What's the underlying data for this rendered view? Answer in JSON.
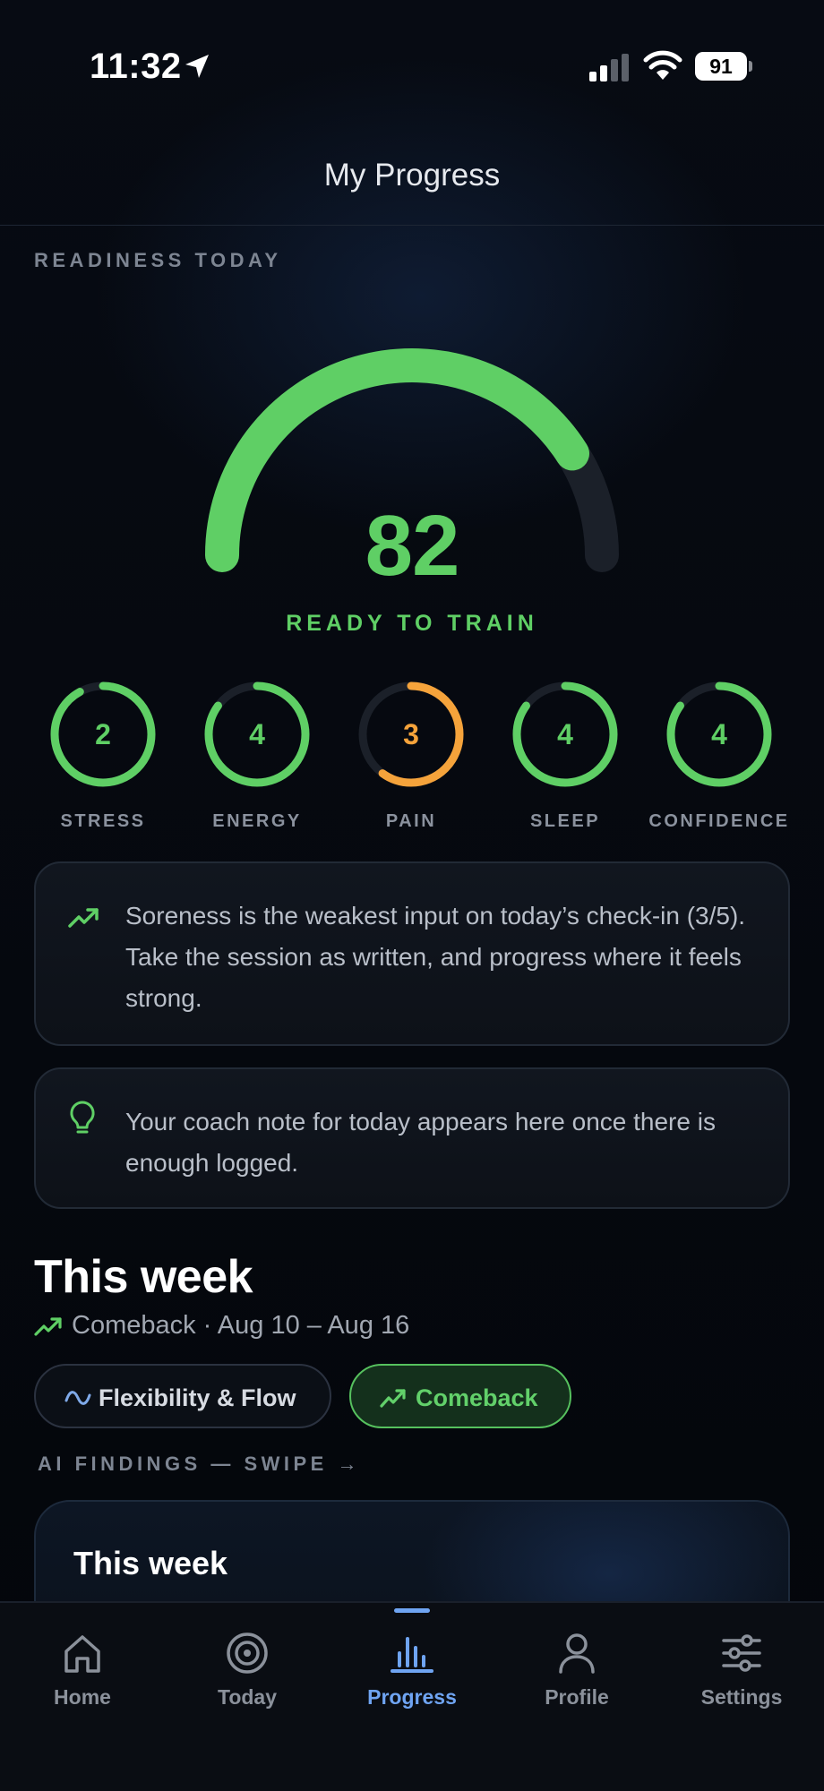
{
  "status_bar": {
    "time": "11:32",
    "battery": "91"
  },
  "header": {
    "title": "My Progress"
  },
  "readiness": {
    "section_label": "READINESS TODAY",
    "score": "82",
    "score_value": 82,
    "status": "READY TO TRAIN"
  },
  "metrics": [
    {
      "label": "STRESS",
      "value": "2",
      "fraction": 0.92,
      "color": "#5fcf65"
    },
    {
      "label": "ENERGY",
      "value": "4",
      "fraction": 0.85,
      "color": "#5fcf65"
    },
    {
      "label": "PAIN",
      "value": "3",
      "fraction": 0.6,
      "color": "#f5a33b"
    },
    {
      "label": "SLEEP",
      "value": "4",
      "fraction": 0.85,
      "color": "#5fcf65"
    },
    {
      "label": "CONFIDENCE",
      "value": "4",
      "fraction": 0.85,
      "color": "#5fcf65"
    }
  ],
  "insight_card": {
    "text": "Soreness is the weakest input on today’s check-in (3/5). Take the session as written, and progress where it feels strong."
  },
  "coach_card": {
    "text": "Your coach note for today appears here once there is enough logged."
  },
  "week": {
    "title": "This week",
    "subtitle": "Comeback · Aug 10 – Aug 16",
    "chips": [
      {
        "label": "Flexibility & Flow",
        "icon": "wave-icon"
      },
      {
        "label": "Comeback",
        "icon": "trending-up-icon",
        "selected": true
      }
    ],
    "findings_label": "AI FINDINGS — SWIPE →",
    "finding_card_title": "This week"
  },
  "tab_bar": {
    "items": [
      {
        "label": "Home",
        "icon": "home-icon"
      },
      {
        "label": "Today",
        "icon": "target-icon"
      },
      {
        "label": "Progress",
        "icon": "bar-chart-icon",
        "active": true
      },
      {
        "label": "Profile",
        "icon": "person-icon"
      },
      {
        "label": "Settings",
        "icon": "sliders-icon"
      }
    ]
  },
  "colors": {
    "accent_green": "#5fcf65",
    "accent_orange": "#f5a33b",
    "accent_blue": "#6fa4f2",
    "background": "#05080e"
  }
}
